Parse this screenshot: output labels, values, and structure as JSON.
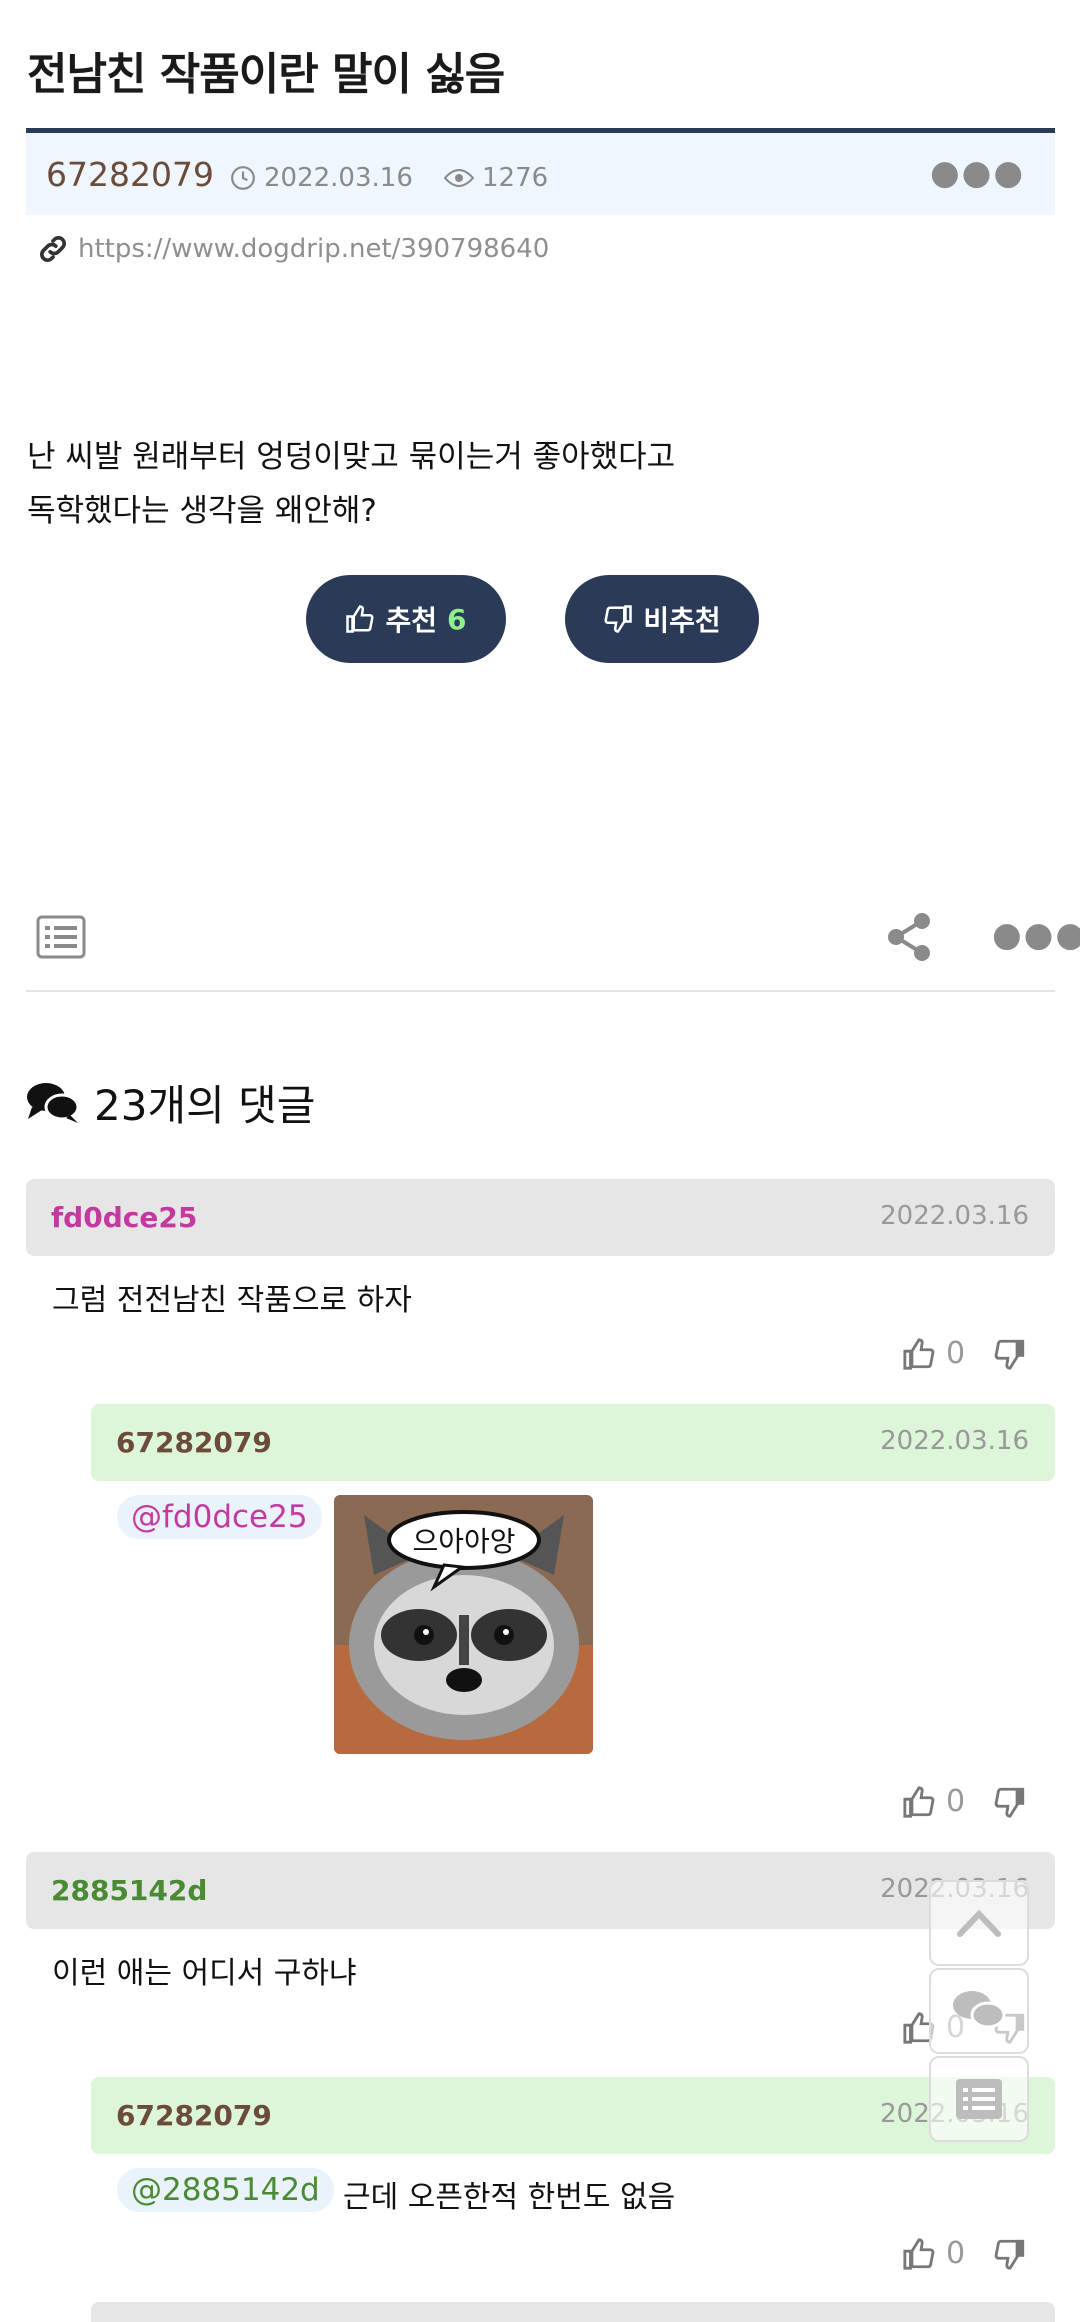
{
  "post": {
    "title": "전남친 작품이란 말이 싫음",
    "author": "67282079",
    "date": "2022.03.16",
    "views": "1276",
    "url": "https://www.dogdrip.net/390798640",
    "body_line1": "난 씨발 원래부터 엉덩이맞고 묶이는거 좋아했다고",
    "body_line2": "독학했다는 생각을 왜안해?",
    "upvote_label": "추천",
    "upvote_count": "6",
    "downvote_label": "비추천"
  },
  "comments_header": "23개의 댓글",
  "comments": [
    {
      "nick": "fd0dce25",
      "date": "2022.03.16",
      "text": "그럼 전전남친 작품으로 하자",
      "up": "0"
    },
    {
      "nick": "67282079",
      "date": "2022.03.16",
      "mention": "@fd0dce25",
      "sticker_text": "으아아앙",
      "up": "0"
    },
    {
      "nick": "2885142d",
      "date": "2022.03.16",
      "text": "이런 애는 어디서 구하냐",
      "up": "0"
    },
    {
      "nick": "67282079",
      "date": "2022.03.16",
      "mention": "@2885142d",
      "text": "근데 오픈한적 한번도 없음",
      "up": "0"
    }
  ],
  "colors": {
    "accent_navy": "#2b3a57",
    "nick_pink": "#c4399f",
    "nick_brown": "#6b4c3b",
    "nick_green": "#4a8a33",
    "mention_blue": "#3a8fd0"
  }
}
